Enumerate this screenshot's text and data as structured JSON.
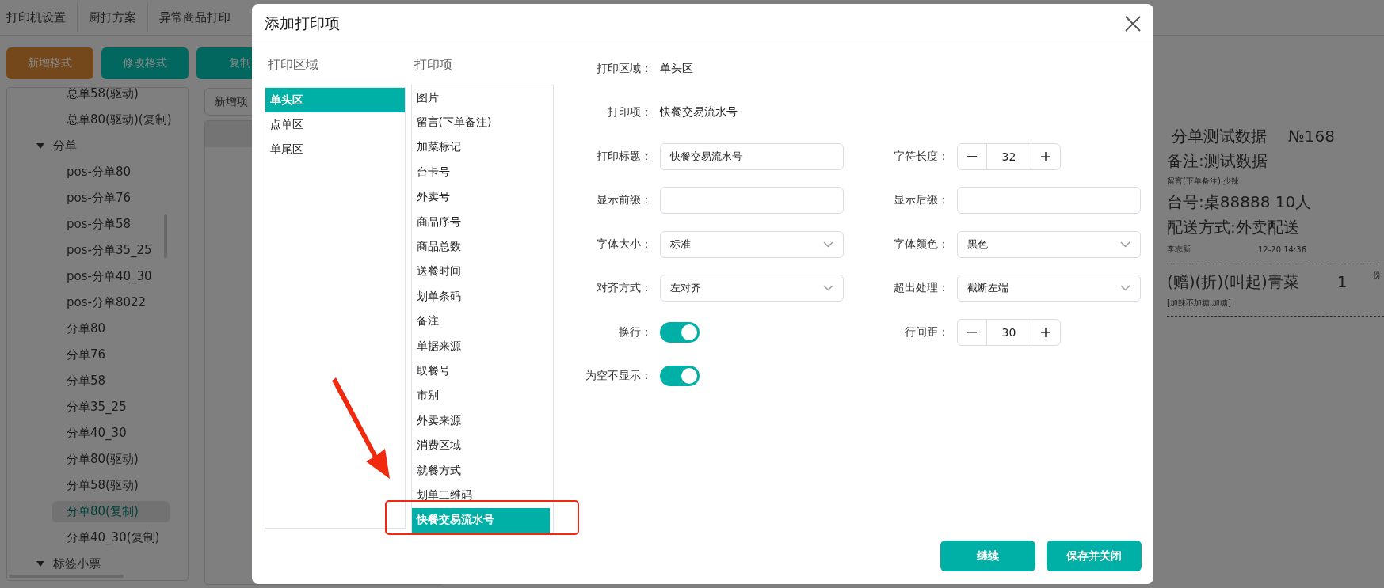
{
  "top_tabs": [
    {
      "label": "打印机设置"
    },
    {
      "label": "厨打方案"
    },
    {
      "label": "异常商品打印"
    }
  ],
  "toolbar": [
    {
      "label": "新增格式",
      "kind": "warning"
    },
    {
      "label": "修改格式",
      "kind": "primary"
    },
    {
      "label": "复制",
      "kind": "primary"
    }
  ],
  "format_tree": [
    {
      "children": [
        {
          "label": "总单58(驱动)",
          "selected": false
        },
        {
          "label": "总单80(驱动)(复制)",
          "selected": false
        }
      ]
    },
    {
      "label": "分单",
      "expanded": true,
      "children": [
        {
          "label": "pos-分单80",
          "selected": false
        },
        {
          "label": "pos-分单76",
          "selected": false
        },
        {
          "label": "pos-分单58",
          "selected": false
        },
        {
          "label": "pos-分单35_25",
          "selected": false
        },
        {
          "label": "pos-分单40_30",
          "selected": false
        },
        {
          "label": "pos-分单8022",
          "selected": false
        },
        {
          "label": "分单80",
          "selected": false
        },
        {
          "label": "分单76",
          "selected": false
        },
        {
          "label": "分单58",
          "selected": false
        },
        {
          "label": "分单35_25",
          "selected": false
        },
        {
          "label": "分单40_30",
          "selected": false
        },
        {
          "label": "分单80(驱动)",
          "selected": false
        },
        {
          "label": "分单58(驱动)",
          "selected": false
        },
        {
          "label": "分单80(复制)",
          "selected": true
        },
        {
          "label": "分单40_30(复制)",
          "selected": false
        }
      ]
    },
    {
      "label": "标签小票",
      "expanded": true
    }
  ],
  "detail_panel": {
    "add_button": "新增项"
  },
  "dialog": {
    "title": "添加打印项",
    "print_areas": {
      "heading": "打印区域",
      "items": [
        {
          "label": "单头区",
          "selected": true
        },
        {
          "label": "点单区",
          "selected": false
        },
        {
          "label": "单尾区",
          "selected": false
        }
      ]
    },
    "print_items": {
      "heading": "打印项",
      "items": [
        {
          "label": "图片",
          "selected": false
        },
        {
          "label": "留言(下单备注)",
          "selected": false
        },
        {
          "label": "加菜标记",
          "selected": false
        },
        {
          "label": "台卡号",
          "selected": false
        },
        {
          "label": "外卖号",
          "selected": false
        },
        {
          "label": "商品序号",
          "selected": false
        },
        {
          "label": "商品总数",
          "selected": false
        },
        {
          "label": "送餐时间",
          "selected": false
        },
        {
          "label": "划单条码",
          "selected": false
        },
        {
          "label": "备注",
          "selected": false
        },
        {
          "label": "单据来源",
          "selected": false
        },
        {
          "label": "取餐号",
          "selected": false
        },
        {
          "label": "市别",
          "selected": false
        },
        {
          "label": "外卖来源",
          "selected": false
        },
        {
          "label": "消费区域",
          "selected": false
        },
        {
          "label": "就餐方式",
          "selected": false
        },
        {
          "label": "划单二维码",
          "selected": false
        },
        {
          "label": "快餐交易流水号",
          "selected": true
        }
      ]
    },
    "form_rows": [
      [
        {
          "kind": "info",
          "label": "打印区域：",
          "value": "单头区"
        }
      ],
      [
        {
          "kind": "info",
          "label": "打印项：",
          "value": "快餐交易流水号"
        }
      ],
      [
        {
          "kind": "input",
          "label": "打印标题：",
          "value": "快餐交易流水号"
        },
        {
          "kind": "stepper",
          "label": "字符长度：",
          "value": "32"
        }
      ],
      [
        {
          "kind": "input",
          "label": "显示前缀："
        },
        {
          "kind": "input",
          "label": "显示后缀："
        }
      ],
      [
        {
          "kind": "select",
          "label": "字体大小：",
          "value": "标准"
        },
        {
          "kind": "select",
          "label": "字体颜色：",
          "value": "黑色"
        }
      ],
      [
        {
          "kind": "select",
          "label": "对齐方式：",
          "value": "左对齐"
        },
        {
          "kind": "select",
          "label": "超出处理：",
          "value": "截断左端"
        }
      ],
      [
        {
          "kind": "switch",
          "label": "换行：",
          "on": true
        },
        {
          "kind": "stepper",
          "label": "行间距：",
          "value": "30"
        }
      ],
      [
        {
          "kind": "switch",
          "label": "为空不显示：",
          "on": true
        }
      ]
    ],
    "buttons": [
      "继续",
      "保存并关闭"
    ]
  },
  "receipt_preview": [
    {
      "kind": "title",
      "text": "分单测试数据",
      "number": "№168"
    },
    {
      "kind": "large",
      "text": "备注:测试数据"
    },
    {
      "kind": "small",
      "text": "留言(下单备注):少辣"
    },
    {
      "kind": "large",
      "text": "台号:桌88888 10人"
    },
    {
      "kind": "large",
      "text": "配送方式:外卖配送"
    },
    {
      "kind": "meta",
      "left": "李志新",
      "right": "12-20 14:36"
    },
    {
      "kind": "divider"
    },
    {
      "kind": "item",
      "name": "(赠)(折)(叫起)青菜",
      "qty": "1",
      "unit": "份"
    },
    {
      "kind": "small",
      "text": "[加辣不加糖,加糖]"
    },
    {
      "kind": "divider"
    }
  ]
}
